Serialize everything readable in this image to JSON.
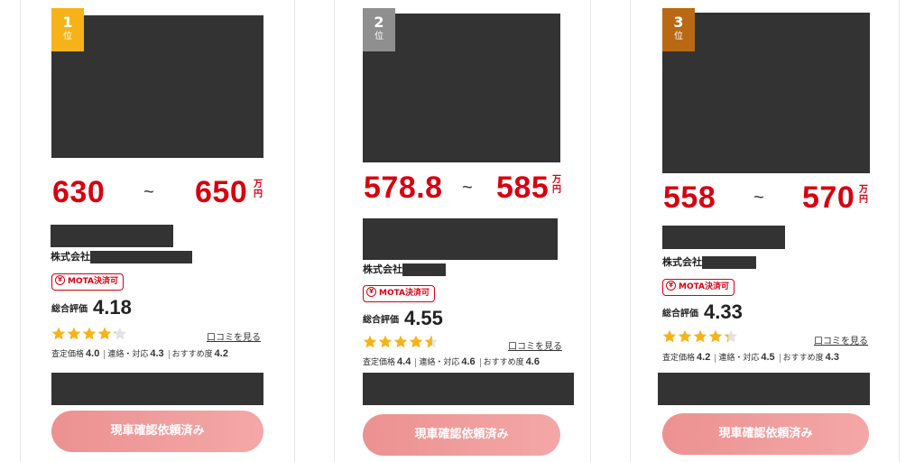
{
  "colors": {
    "gold": "#f6b319",
    "silver": "#8f8f8f",
    "bronze": "#b96914",
    "price_red": "#d7000f",
    "star": "#f6b319",
    "button": "#f09a9a",
    "redaction": "#333333"
  },
  "rank_unit": "位",
  "tilde": "~",
  "price_unit": "万円",
  "company_prefix": "株式会社",
  "badge_label": "MOTA決済可",
  "yen_symbol": "¥",
  "overall_label": "総合評価",
  "review_link": "口コミを見る",
  "sub_labels": {
    "price": "査定価格",
    "contact": "連絡・対応",
    "recommend": "おすすめ度"
  },
  "button_label": "現車確認依頼済み",
  "cards": [
    {
      "rank": "1",
      "price_low": "630",
      "price_high": "650",
      "rating": "4.18",
      "rating_value": 4.18,
      "scores": {
        "price": "4.0",
        "contact": "4.3",
        "recommend": "4.2"
      }
    },
    {
      "rank": "2",
      "price_low": "578.8",
      "price_high": "585",
      "rating": "4.55",
      "rating_value": 4.55,
      "scores": {
        "price": "4.4",
        "contact": "4.6",
        "recommend": "4.6"
      }
    },
    {
      "rank": "3",
      "price_low": "558",
      "price_high": "570",
      "rating": "4.33",
      "rating_value": 4.33,
      "scores": {
        "price": "4.2",
        "contact": "4.5",
        "recommend": "4.3"
      }
    }
  ]
}
